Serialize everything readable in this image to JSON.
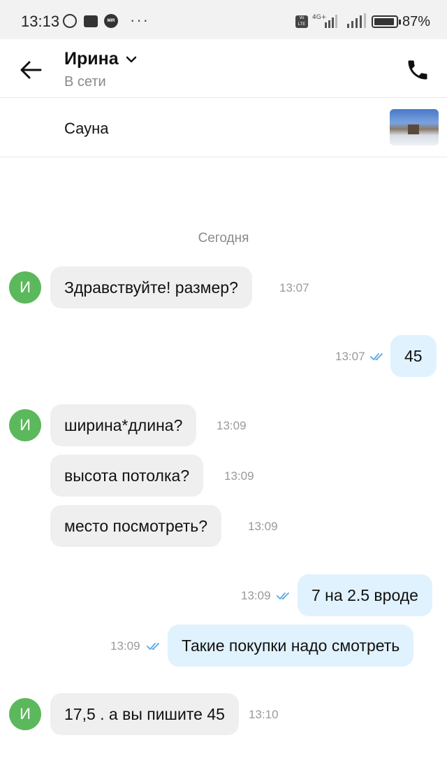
{
  "status_bar": {
    "time": "13:13",
    "network": "4G+",
    "volte": "Vo LTE",
    "mir": "MIR",
    "battery": "87%",
    "icons": [
      "whatsapp-icon",
      "mail-icon",
      "mir-icon",
      "more-icon",
      "volte-icon",
      "signal-icon",
      "battery-icon"
    ]
  },
  "header": {
    "contact_name": "Ирина",
    "contact_status": "В сети"
  },
  "item": {
    "title": "Сауна"
  },
  "chat": {
    "date_separator": "Сегодня",
    "avatar_letter": "И",
    "messages": [
      {
        "direction": "in",
        "text": "Здравствуйте! размер?",
        "time": "13:07"
      },
      {
        "direction": "out",
        "text": "45",
        "time": "13:07",
        "read": true
      },
      {
        "direction": "in",
        "text": "ширина*длина?",
        "time": "13:09"
      },
      {
        "direction": "in",
        "text": "высота потолка?",
        "time": "13:09"
      },
      {
        "direction": "in",
        "text": "место посмотреть?",
        "time": "13:09"
      },
      {
        "direction": "out",
        "text": "7 на 2.5 вроде",
        "time": "13:09",
        "read": true
      },
      {
        "direction": "out",
        "text": "Такие покупки надо смотреть",
        "time": "13:09",
        "read": true
      },
      {
        "direction": "in",
        "text": "17,5 . а вы пишите 45",
        "time": "13:10"
      }
    ]
  },
  "colors": {
    "incoming_bubble": "#efefef",
    "outgoing_bubble": "#e0f2fe",
    "avatar": "#5cb85c",
    "read_checks": "#5aa9e6"
  }
}
